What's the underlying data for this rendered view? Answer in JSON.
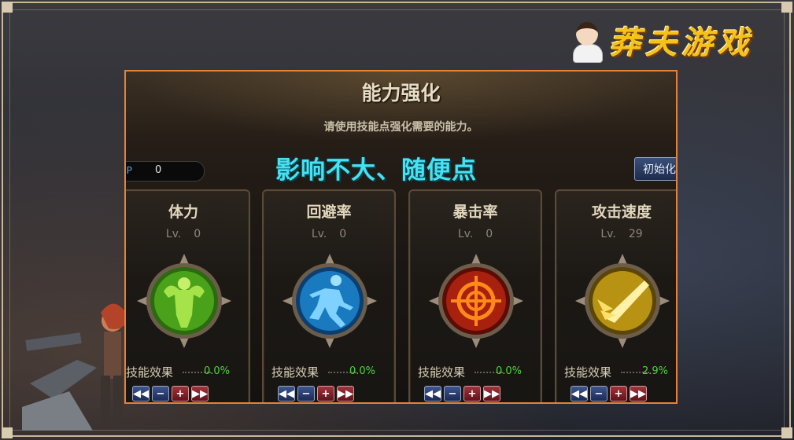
{
  "brand": {
    "text": "莽夫游戏"
  },
  "panel": {
    "title": "能力强化",
    "subtitle": "请使用技能点强化需要的能力。",
    "sp_label": "SP",
    "sp_value": "0",
    "reset_label": "初始化"
  },
  "overlay_text": "影响不大、随便点",
  "cards": [
    {
      "name": "体力",
      "lv_label": "Lv.",
      "lv": "0",
      "effect_label": "技能效果",
      "effect_value": "0.0%",
      "icon": "strength-icon"
    },
    {
      "name": "回避率",
      "lv_label": "Lv.",
      "lv": "0",
      "effect_label": "技能效果",
      "effect_value": "0.0%",
      "icon": "evasion-icon"
    },
    {
      "name": "暴击率",
      "lv_label": "Lv.",
      "lv": "0",
      "effect_label": "技能效果",
      "effect_value": "0.0%",
      "icon": "crosshair-icon"
    },
    {
      "name": "攻击速度",
      "lv_label": "Lv.",
      "lv": "29",
      "effect_label": "技能效果",
      "effect_value": "2.9%",
      "icon": "attack-speed-icon"
    }
  ],
  "controls": {
    "first": "◀◀",
    "minus": "−",
    "plus": "+",
    "last": "▶▶"
  },
  "colors": {
    "accent_border": "#e5813a",
    "overlay": "#46e1f2",
    "effect_value": "#4cd43a",
    "brand": "#f5c21a"
  }
}
